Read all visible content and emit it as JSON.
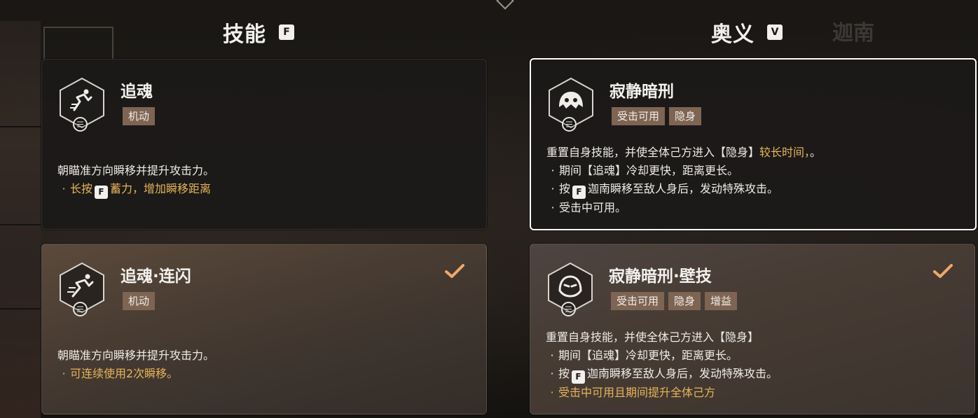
{
  "headers": {
    "skill": {
      "title": "技能",
      "key": "F"
    },
    "ultimate": {
      "title": "奥义",
      "key": "V"
    }
  },
  "background": {
    "ghost_title": "迦南"
  },
  "cards": {
    "skill_base": {
      "name": "追魂",
      "icon": "dash-icon",
      "tags": [
        "机动"
      ],
      "desc_main": "朝瞄准方向瞬移并提升攻击力。",
      "desc_b1_pre": "长按",
      "desc_b1_key": "F",
      "desc_b1_post": "蓄力，增加瞬移距离",
      "selected": false
    },
    "skill_lib": {
      "name": "追魂·连闪",
      "icon": "dash-icon",
      "tags": [
        "机动"
      ],
      "desc_main": "朝瞄准方向瞬移并提升攻击力。",
      "desc_b1": "可连续使用2次瞬移。",
      "selected": true
    },
    "ult_base": {
      "name": "寂静暗刑",
      "icon": "mask-icon",
      "tags": [
        "受击可用",
        "隐身"
      ],
      "desc_main_pre": "重置自身技能，并使全体己方进入【隐身】",
      "desc_main_gold": "较长时间，",
      "desc_main_post": "。",
      "desc_b1": "期间【追魂】冷却更快，距离更长。",
      "desc_b2_pre": "按",
      "desc_b2_key": "F",
      "desc_b2_post": "迦南瞬移至敌人身后，发动特殊攻击。",
      "desc_b3": "受击中可用。",
      "focused": true
    },
    "ult_lib": {
      "name": "寂静暗刑·壁技",
      "icon": "mask-icon",
      "tags": [
        "受击可用",
        "隐身",
        "增益"
      ],
      "desc_main": "重置自身技能，并使全体己方进入【隐身】",
      "desc_b1": "期间【追魂】冷却更快，距离更长。",
      "desc_b2_pre": "按",
      "desc_b2_key": "F",
      "desc_b2_post": "迦南瞬移至敌人身后，发动特殊攻击。",
      "desc_b3": "受击中可用且期间提升全体己方",
      "selected": true
    }
  },
  "colors": {
    "gold": "#e6b45a",
    "check": "#f0a86a",
    "tag_bg": "#7d6453"
  }
}
